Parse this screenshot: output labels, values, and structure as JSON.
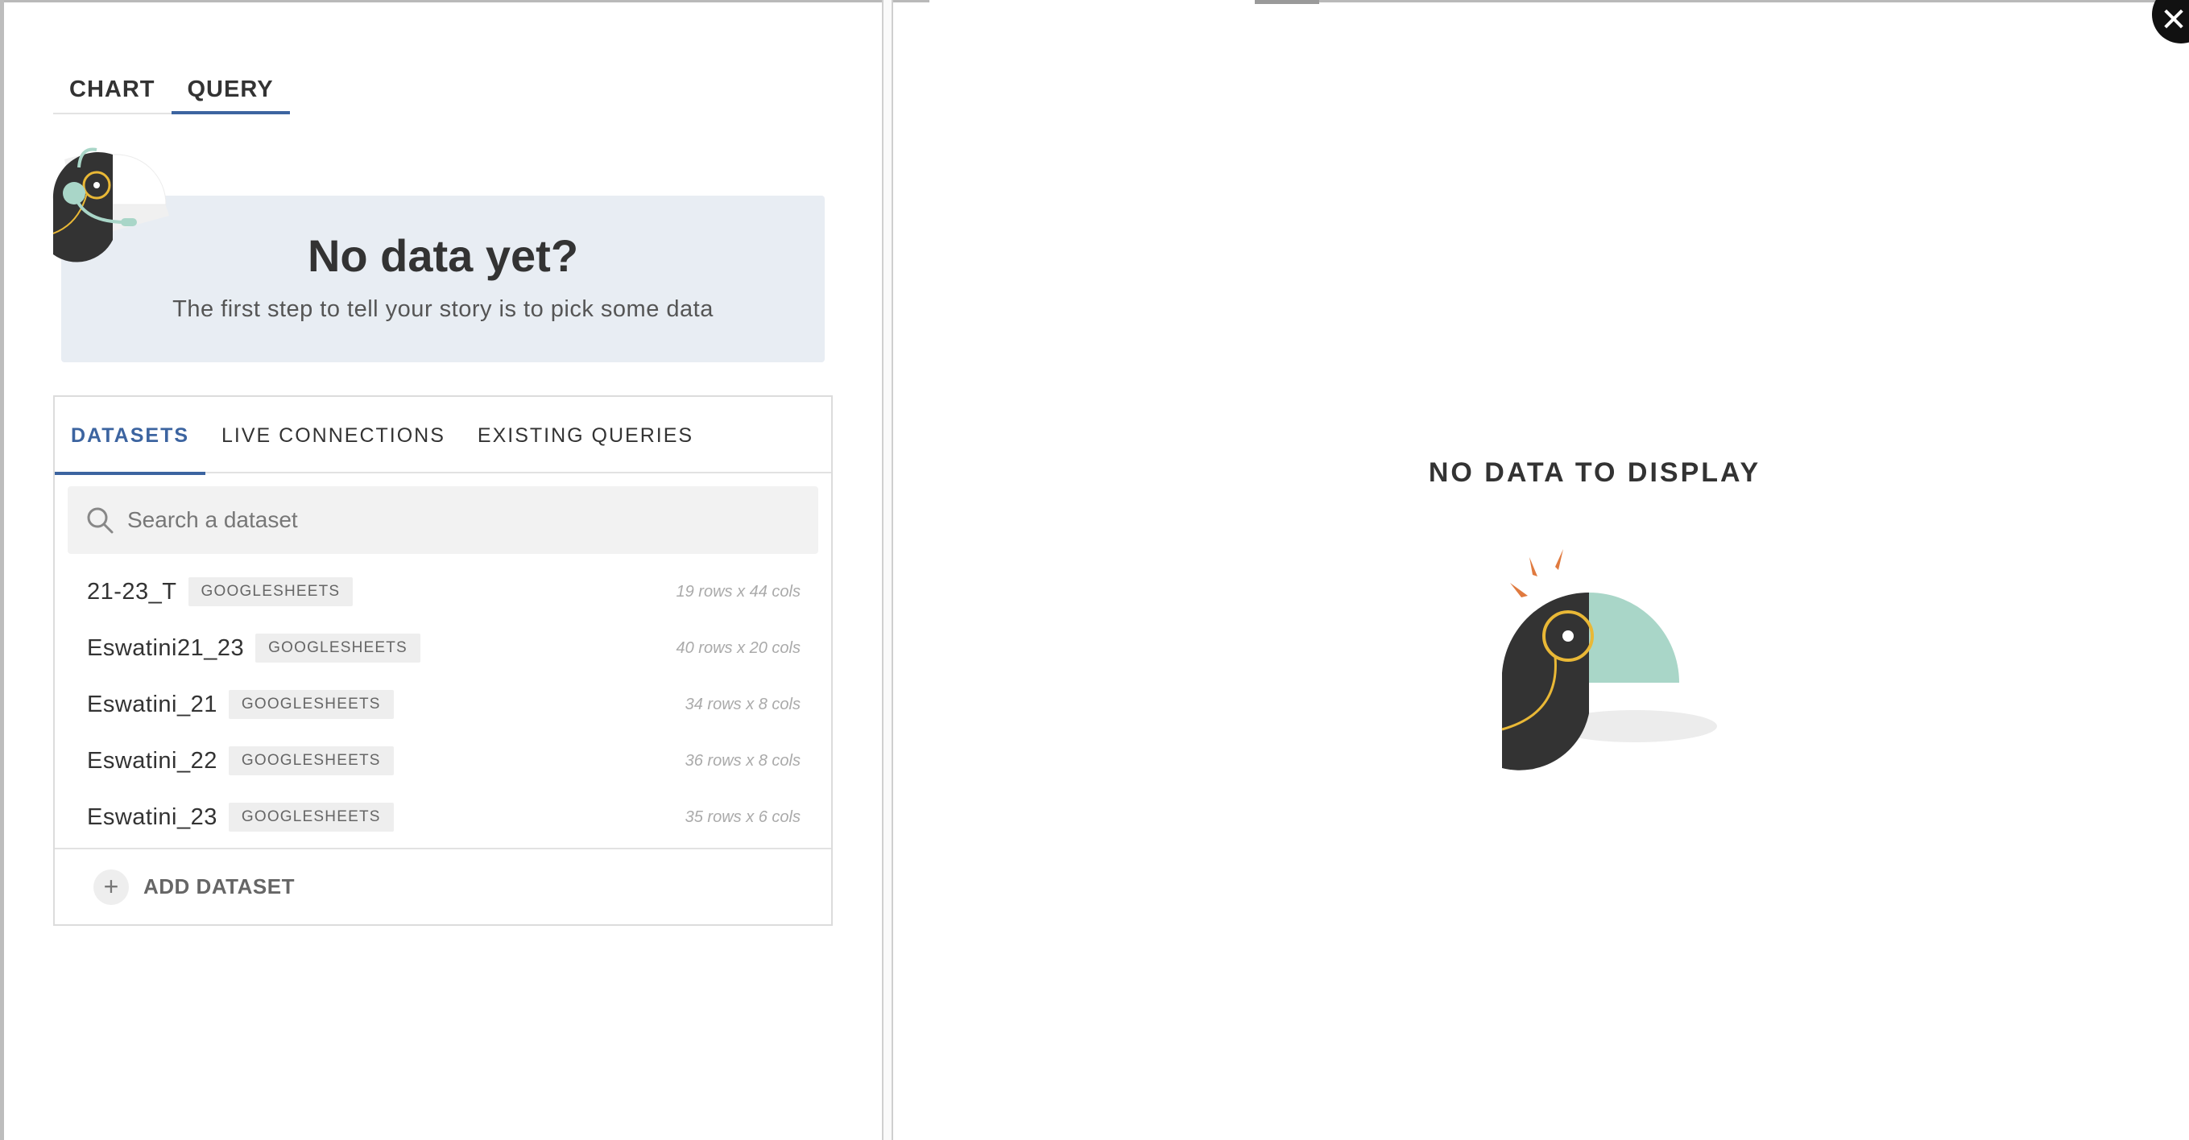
{
  "mode_tabs": [
    {
      "label": "CHART"
    },
    {
      "label": "QUERY"
    }
  ],
  "hero": {
    "title": "No data yet?",
    "subtitle": "The first step to tell your story is to pick some data"
  },
  "dataset_tabs": [
    {
      "label": "DATASETS"
    },
    {
      "label": "LIVE CONNECTIONS"
    },
    {
      "label": "EXISTING QUERIES"
    }
  ],
  "search": {
    "placeholder": "Search a dataset",
    "value": ""
  },
  "datasets": [
    {
      "name": "21-23_T",
      "source": "GOOGLESHEETS",
      "size": "19 rows x 44 cols"
    },
    {
      "name": "Eswatini21_23",
      "source": "GOOGLESHEETS",
      "size": "40 rows x 20 cols"
    },
    {
      "name": "Eswatini_21",
      "source": "GOOGLESHEETS",
      "size": "34 rows x 8 cols"
    },
    {
      "name": "Eswatini_22",
      "source": "GOOGLESHEETS",
      "size": "36 rows x 8 cols"
    },
    {
      "name": "Eswatini_23",
      "source": "GOOGLESHEETS",
      "size": "35 rows x 6 cols"
    }
  ],
  "add_dataset": {
    "label": "ADD DATASET",
    "icon": "plus-icon"
  },
  "empty_state": {
    "title": "NO DATA TO DISPLAY"
  },
  "close": {
    "glyph": "✕",
    "icon": "close-icon"
  },
  "colors": {
    "accent": "#3c64a0",
    "hero_bg": "#e8edf3",
    "bird_dark": "#333333",
    "bird_teal": "#a9d6c8",
    "bird_gold": "#e9b836",
    "spark": "#e07a3f"
  }
}
